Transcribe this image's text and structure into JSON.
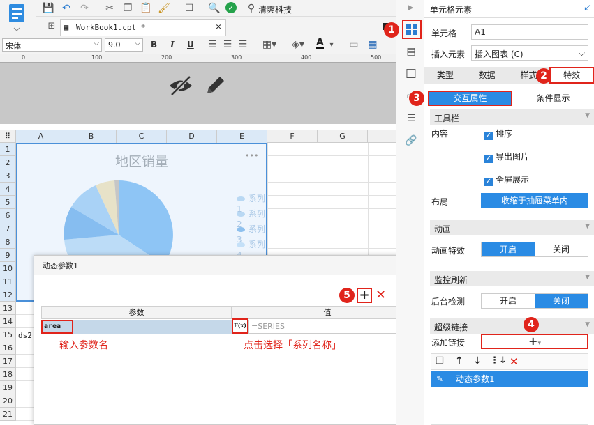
{
  "toolbar": {
    "brand": "清爽科技"
  },
  "tab": {
    "title": "WorkBook1.cpt *"
  },
  "format": {
    "font": "宋体",
    "size": "9.0",
    "bold": "B",
    "italic": "I",
    "underline": "U",
    "font_color_glyph": "A"
  },
  "ruler": {
    "labels": [
      "0",
      "100",
      "200",
      "300",
      "400",
      "500"
    ]
  },
  "sheet": {
    "columns": [
      "A",
      "B",
      "C",
      "D",
      "E",
      "F",
      "G"
    ],
    "rows": [
      "1",
      "2",
      "3",
      "4",
      "5",
      "6",
      "7",
      "8",
      "9",
      "10",
      "11",
      "12",
      "13",
      "14",
      "15",
      "16",
      "17",
      "18",
      "19",
      "20",
      "21"
    ],
    "cell_a15": "ds2."
  },
  "chart": {
    "title": "地区销量",
    "more": "•••",
    "legend": [
      "系列1",
      "系列2",
      "系列3",
      "系列4"
    ],
    "colors": [
      "#8ec5f5",
      "#bcdcf7",
      "#86bdf0",
      "#a9d2f6",
      "#e7e2c8",
      "#c6c6c6"
    ]
  },
  "dialog": {
    "title": "动态参数1",
    "col_param": "参数",
    "col_value": "值",
    "param_name": "area",
    "formula_btn": "F(x)",
    "value": "=SERIES",
    "hint_param": "输入参数名",
    "hint_value": "点击选择「系列名称」",
    "step5": "5"
  },
  "panel": {
    "header": "单元格元素",
    "cell_label": "单元格",
    "cell_value": "A1",
    "insert_label": "插入元素",
    "insert_value": "插入图表 (C)",
    "tabs": [
      "类型",
      "数据",
      "样式",
      "特效"
    ],
    "subtabs": [
      "交互属性",
      "条件显示"
    ],
    "toolbar_section": "工具栏",
    "content_label": "内容",
    "checks": [
      "排序",
      "导出图片",
      "全屏展示"
    ],
    "layout_label": "布局",
    "layout_value": "收缩于抽屉菜单内",
    "anim_section": "动画",
    "anim_label": "动画特效",
    "anim_on": "开启",
    "anim_off": "关闭",
    "monitor_section": "监控刷新",
    "backend_label": "后台检测",
    "backend_on": "开启",
    "backend_off": "关闭",
    "link_section": "超级链接",
    "add_link_label": "添加链接",
    "add_glyph": "+",
    "link_item": "动态参数1"
  },
  "steps": {
    "s1": "1",
    "s2": "2",
    "s3": "3",
    "s4": "4"
  }
}
